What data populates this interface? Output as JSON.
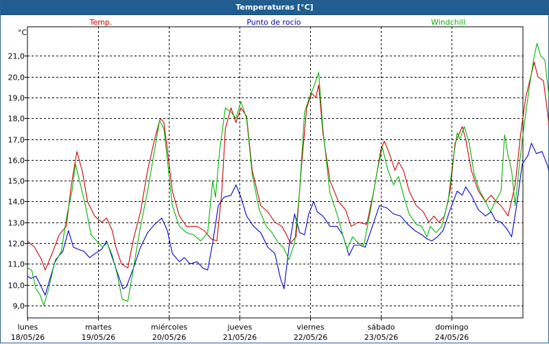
{
  "window_title": "Temperaturas [°C]",
  "chart_data": {
    "type": "line",
    "title": "Temperaturas [°C]",
    "ylabel": "°C",
    "ylim": [
      8.4,
      22.4
    ],
    "yticks": [
      9.0,
      10.0,
      11.0,
      12.0,
      13.0,
      14.0,
      15.0,
      16.0,
      17.0,
      18.0,
      19.0,
      20.0,
      21.0
    ],
    "ytick_labels": [
      "9,0",
      "10,0",
      "11,0",
      "12,0",
      "13,0",
      "14,0",
      "15,0",
      "16,0",
      "17,0",
      "18,0",
      "19,0",
      "20,0",
      "21,0"
    ],
    "xlim": [
      0,
      7
    ],
    "grid": true,
    "legend_placement": "top",
    "days": [
      {
        "name": "lunes",
        "date": "18/05/26"
      },
      {
        "name": "martes",
        "date": "19/05/26"
      },
      {
        "name": "miércoles",
        "date": "20/05/26"
      },
      {
        "name": "jueves",
        "date": "21/05/26"
      },
      {
        "name": "viernes",
        "date": "22/05/26"
      },
      {
        "name": "sábado",
        "date": "23/05/26"
      },
      {
        "name": "domingo",
        "date": "24/05/26"
      }
    ],
    "series": [
      {
        "name": "Temp.",
        "color": "#cc0000",
        "values": [
          [
            0.0,
            12.1
          ],
          [
            0.1,
            11.8
          ],
          [
            0.2,
            11.2
          ],
          [
            0.25,
            10.7
          ],
          [
            0.35,
            11.5
          ],
          [
            0.45,
            12.4
          ],
          [
            0.55,
            12.8
          ],
          [
            0.62,
            14.8
          ],
          [
            0.7,
            16.4
          ],
          [
            0.78,
            15.4
          ],
          [
            0.85,
            14.0
          ],
          [
            0.95,
            13.3
          ],
          [
            1.05,
            13.0
          ],
          [
            1.12,
            13.2
          ],
          [
            1.2,
            12.6
          ],
          [
            1.25,
            11.8
          ],
          [
            1.33,
            11.0
          ],
          [
            1.42,
            10.8
          ],
          [
            1.5,
            12.2
          ],
          [
            1.6,
            13.5
          ],
          [
            1.7,
            15.5
          ],
          [
            1.8,
            17.0
          ],
          [
            1.88,
            18.0
          ],
          [
            1.93,
            17.8
          ],
          [
            1.98,
            16.5
          ],
          [
            2.05,
            14.5
          ],
          [
            2.15,
            13.3
          ],
          [
            2.25,
            12.8
          ],
          [
            2.4,
            12.8
          ],
          [
            2.5,
            12.6
          ],
          [
            2.6,
            12.2
          ],
          [
            2.68,
            12.1
          ],
          [
            2.75,
            14.5
          ],
          [
            2.8,
            17.5
          ],
          [
            2.88,
            18.5
          ],
          [
            2.95,
            17.8
          ],
          [
            3.02,
            18.5
          ],
          [
            3.1,
            18.1
          ],
          [
            3.18,
            15.5
          ],
          [
            3.3,
            13.8
          ],
          [
            3.4,
            13.5
          ],
          [
            3.5,
            13.0
          ],
          [
            3.6,
            12.8
          ],
          [
            3.65,
            12.5
          ],
          [
            3.72,
            12.0
          ],
          [
            3.8,
            12.3
          ],
          [
            3.88,
            15.8
          ],
          [
            3.95,
            18.5
          ],
          [
            4.02,
            19.2
          ],
          [
            4.08,
            19.0
          ],
          [
            4.12,
            19.6
          ],
          [
            4.18,
            17.3
          ],
          [
            4.28,
            15.0
          ],
          [
            4.4,
            14.0
          ],
          [
            4.5,
            13.6
          ],
          [
            4.58,
            12.8
          ],
          [
            4.68,
            13.0
          ],
          [
            4.8,
            12.9
          ],
          [
            4.9,
            14.5
          ],
          [
            5.0,
            16.5
          ],
          [
            5.05,
            16.9
          ],
          [
            5.12,
            16.3
          ],
          [
            5.2,
            15.5
          ],
          [
            5.25,
            15.9
          ],
          [
            5.32,
            15.5
          ],
          [
            5.4,
            14.5
          ],
          [
            5.5,
            13.8
          ],
          [
            5.6,
            13.5
          ],
          [
            5.68,
            13.0
          ],
          [
            5.75,
            13.3
          ],
          [
            5.82,
            13.0
          ],
          [
            5.9,
            13.3
          ],
          [
            5.98,
            14.5
          ],
          [
            6.05,
            16.8
          ],
          [
            6.1,
            17.2
          ],
          [
            6.15,
            17.6
          ],
          [
            6.2,
            17.0
          ],
          [
            6.28,
            15.5
          ],
          [
            6.38,
            14.5
          ],
          [
            6.48,
            14.0
          ],
          [
            6.56,
            14.3
          ],
          [
            6.63,
            14.0
          ],
          [
            6.7,
            13.8
          ],
          [
            6.8,
            13.3
          ],
          [
            6.9,
            14.8
          ],
          [
            6.98,
            17.3
          ],
          [
            7.05,
            19.0
          ],
          [
            7.12,
            20.0
          ],
          [
            7.17,
            20.7
          ],
          [
            7.22,
            20.0
          ],
          [
            7.3,
            19.8
          ],
          [
            7.35,
            18.5
          ],
          [
            7.42,
            16.5
          ],
          [
            7.48,
            15.8
          ],
          [
            7.53,
            15.3
          ],
          [
            7.6,
            14.5
          ],
          [
            7.65,
            14.0
          ]
        ]
      },
      {
        "name": "Punto de rocío",
        "color": "#0000cc",
        "values": [
          [
            0.0,
            10.4
          ],
          [
            0.05,
            10.3
          ],
          [
            0.12,
            10.4
          ],
          [
            0.18,
            10.0
          ],
          [
            0.25,
            9.5
          ],
          [
            0.32,
            10.3
          ],
          [
            0.4,
            11.2
          ],
          [
            0.5,
            11.6
          ],
          [
            0.58,
            12.6
          ],
          [
            0.65,
            11.8
          ],
          [
            0.72,
            11.7
          ],
          [
            0.8,
            11.6
          ],
          [
            0.88,
            11.3
          ],
          [
            0.96,
            11.5
          ],
          [
            1.05,
            11.7
          ],
          [
            1.12,
            12.1
          ],
          [
            1.2,
            11.3
          ],
          [
            1.28,
            10.5
          ],
          [
            1.35,
            9.8
          ],
          [
            1.4,
            9.9
          ],
          [
            1.5,
            10.8
          ],
          [
            1.6,
            11.8
          ],
          [
            1.7,
            12.5
          ],
          [
            1.8,
            12.9
          ],
          [
            1.9,
            13.2
          ],
          [
            1.98,
            12.6
          ],
          [
            2.05,
            11.5
          ],
          [
            2.15,
            11.1
          ],
          [
            2.22,
            11.3
          ],
          [
            2.3,
            11.0
          ],
          [
            2.4,
            11.1
          ],
          [
            2.48,
            10.8
          ],
          [
            2.55,
            10.7
          ],
          [
            2.62,
            12.0
          ],
          [
            2.7,
            13.8
          ],
          [
            2.78,
            14.2
          ],
          [
            2.88,
            14.3
          ],
          [
            2.95,
            14.8
          ],
          [
            3.02,
            14.2
          ],
          [
            3.1,
            13.3
          ],
          [
            3.2,
            12.8
          ],
          [
            3.3,
            12.5
          ],
          [
            3.4,
            11.8
          ],
          [
            3.5,
            11.5
          ],
          [
            3.58,
            10.3
          ],
          [
            3.63,
            9.8
          ],
          [
            3.7,
            11.8
          ],
          [
            3.78,
            13.4
          ],
          [
            3.85,
            12.5
          ],
          [
            3.92,
            12.4
          ],
          [
            3.98,
            13.4
          ],
          [
            4.05,
            14.0
          ],
          [
            4.1,
            13.5
          ],
          [
            4.18,
            13.3
          ],
          [
            4.28,
            12.8
          ],
          [
            4.38,
            12.8
          ],
          [
            4.46,
            12.4
          ],
          [
            4.55,
            11.4
          ],
          [
            4.62,
            11.9
          ],
          [
            4.7,
            11.9
          ],
          [
            4.78,
            11.8
          ],
          [
            4.88,
            12.8
          ],
          [
            4.98,
            13.8
          ],
          [
            5.08,
            13.7
          ],
          [
            5.18,
            13.4
          ],
          [
            5.28,
            13.3
          ],
          [
            5.38,
            12.9
          ],
          [
            5.48,
            12.6
          ],
          [
            5.58,
            12.4
          ],
          [
            5.65,
            12.2
          ],
          [
            5.72,
            12.1
          ],
          [
            5.8,
            12.3
          ],
          [
            5.88,
            12.6
          ],
          [
            5.98,
            13.6
          ],
          [
            6.08,
            14.5
          ],
          [
            6.15,
            14.3
          ],
          [
            6.2,
            14.7
          ],
          [
            6.28,
            14.3
          ],
          [
            6.38,
            13.6
          ],
          [
            6.48,
            13.3
          ],
          [
            6.56,
            13.5
          ],
          [
            6.62,
            13.1
          ],
          [
            6.7,
            13.0
          ],
          [
            6.78,
            12.7
          ],
          [
            6.85,
            12.3
          ],
          [
            6.92,
            13.8
          ],
          [
            7.0,
            15.8
          ],
          [
            7.08,
            16.2
          ],
          [
            7.13,
            16.8
          ],
          [
            7.2,
            16.3
          ],
          [
            7.28,
            16.4
          ],
          [
            7.35,
            15.8
          ],
          [
            7.42,
            15.0
          ],
          [
            7.5,
            14.3
          ],
          [
            7.58,
            13.5
          ],
          [
            7.65,
            13.0
          ]
        ]
      },
      {
        "name": "Windchill",
        "color": "#00b300",
        "values": [
          [
            0.0,
            10.8
          ],
          [
            0.06,
            10.7
          ],
          [
            0.12,
            9.8
          ],
          [
            0.18,
            9.5
          ],
          [
            0.23,
            9.0
          ],
          [
            0.3,
            9.8
          ],
          [
            0.38,
            11.0
          ],
          [
            0.48,
            11.6
          ],
          [
            0.55,
            13.2
          ],
          [
            0.63,
            14.5
          ],
          [
            0.68,
            15.8
          ],
          [
            0.75,
            14.8
          ],
          [
            0.82,
            13.8
          ],
          [
            0.9,
            12.4
          ],
          [
            0.98,
            12.1
          ],
          [
            1.06,
            11.8
          ],
          [
            1.13,
            12.0
          ],
          [
            1.2,
            11.4
          ],
          [
            1.27,
            10.5
          ],
          [
            1.34,
            9.3
          ],
          [
            1.42,
            9.2
          ],
          [
            1.5,
            10.8
          ],
          [
            1.6,
            12.8
          ],
          [
            1.7,
            14.5
          ],
          [
            1.8,
            16.5
          ],
          [
            1.87,
            17.9
          ],
          [
            1.93,
            17.5
          ],
          [
            1.98,
            16.0
          ],
          [
            2.05,
            13.8
          ],
          [
            2.15,
            12.8
          ],
          [
            2.25,
            12.5
          ],
          [
            2.35,
            12.4
          ],
          [
            2.45,
            12.1
          ],
          [
            2.55,
            12.5
          ],
          [
            2.62,
            15.0
          ],
          [
            2.66,
            14.2
          ],
          [
            2.72,
            16.5
          ],
          [
            2.8,
            18.5
          ],
          [
            2.88,
            18.3
          ],
          [
            2.95,
            18.0
          ],
          [
            3.02,
            18.8
          ],
          [
            3.1,
            18.0
          ],
          [
            3.18,
            15.3
          ],
          [
            3.28,
            13.6
          ],
          [
            3.38,
            12.8
          ],
          [
            3.46,
            12.5
          ],
          [
            3.55,
            12.0
          ],
          [
            3.62,
            11.8
          ],
          [
            3.7,
            11.2
          ],
          [
            3.78,
            12.0
          ],
          [
            3.85,
            14.5
          ],
          [
            3.92,
            18.3
          ],
          [
            4.0,
            19.1
          ],
          [
            4.05,
            19.5
          ],
          [
            4.12,
            20.2
          ],
          [
            4.18,
            17.5
          ],
          [
            4.28,
            14.4
          ],
          [
            4.38,
            13.4
          ],
          [
            4.46,
            12.4
          ],
          [
            4.52,
            11.7
          ],
          [
            4.6,
            12.3
          ],
          [
            4.68,
            12.0
          ],
          [
            4.76,
            11.9
          ],
          [
            4.85,
            13.5
          ],
          [
            4.95,
            15.5
          ],
          [
            5.02,
            16.6
          ],
          [
            5.1,
            15.5
          ],
          [
            5.18,
            14.8
          ],
          [
            5.25,
            15.2
          ],
          [
            5.32,
            14.3
          ],
          [
            5.4,
            13.4
          ],
          [
            5.5,
            12.9
          ],
          [
            5.58,
            12.8
          ],
          [
            5.65,
            12.3
          ],
          [
            5.7,
            12.8
          ],
          [
            5.78,
            12.5
          ],
          [
            5.86,
            12.8
          ],
          [
            5.95,
            14.0
          ],
          [
            6.02,
            16.0
          ],
          [
            6.08,
            17.3
          ],
          [
            6.12,
            17.0
          ],
          [
            6.18,
            17.6
          ],
          [
            6.25,
            16.8
          ],
          [
            6.32,
            15.3
          ],
          [
            6.4,
            14.5
          ],
          [
            6.48,
            14.0
          ],
          [
            6.55,
            13.5
          ],
          [
            6.62,
            14.0
          ],
          [
            6.7,
            14.5
          ],
          [
            6.75,
            17.2
          ],
          [
            6.8,
            16.2
          ],
          [
            6.85,
            15.5
          ],
          [
            6.9,
            13.8
          ],
          [
            6.95,
            15.5
          ],
          [
            7.02,
            17.5
          ],
          [
            7.1,
            19.5
          ],
          [
            7.17,
            21.0
          ],
          [
            7.21,
            21.6
          ],
          [
            7.26,
            21.0
          ],
          [
            7.32,
            20.8
          ],
          [
            7.38,
            19.0
          ],
          [
            7.43,
            17.2
          ],
          [
            7.48,
            16.8
          ],
          [
            7.53,
            17.3
          ],
          [
            7.6,
            15.8
          ],
          [
            7.65,
            14.5
          ]
        ]
      }
    ]
  }
}
